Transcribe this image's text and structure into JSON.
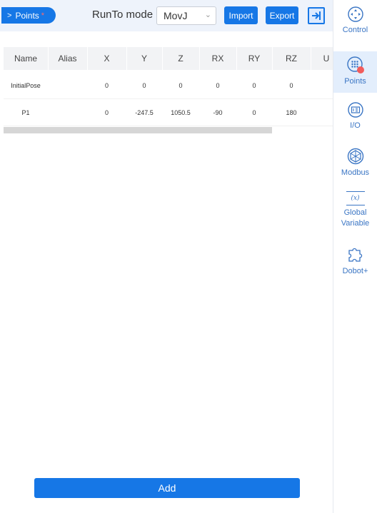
{
  "header": {
    "points_tab_label": "Points",
    "modified_marker": "*",
    "runto_label": "RunTo mode",
    "runto_value": "MovJ",
    "import_label": "Import",
    "export_label": "Export"
  },
  "table": {
    "columns": [
      "Name",
      "Alias",
      "X",
      "Y",
      "Z",
      "RX",
      "RY",
      "RZ",
      "U"
    ],
    "rows": [
      [
        "InitialPose",
        "",
        "0",
        "0",
        "0",
        "0",
        "0",
        "0"
      ],
      [
        "P1",
        "",
        "0",
        "-247.5",
        "1050.5",
        "-90",
        "0",
        "180"
      ]
    ]
  },
  "add_label": "Add",
  "sidebar": {
    "items": [
      {
        "label": "Control",
        "icon": "control-icon"
      },
      {
        "label": "Points",
        "icon": "points-icon",
        "active": true
      },
      {
        "label": "I/O",
        "icon": "io-icon"
      },
      {
        "label": "Modbus",
        "icon": "modbus-icon"
      },
      {
        "label": "Global\nVariable",
        "icon": "global-variable-icon",
        "glyph": "(x)"
      },
      {
        "label": "Dobot+",
        "icon": "puzzle-icon"
      }
    ]
  },
  "colors": {
    "accent": "#1677e6",
    "notification_dot": "#f25c5c"
  }
}
